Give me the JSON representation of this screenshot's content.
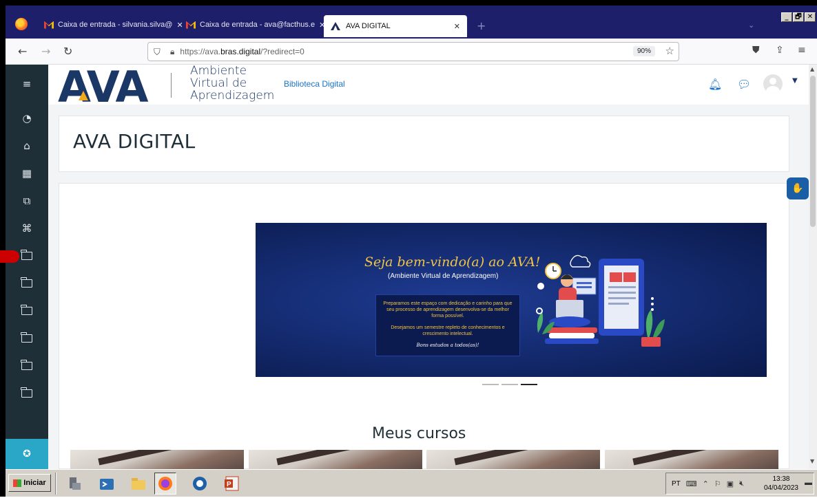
{
  "browser": {
    "tabs": [
      {
        "label": "Caixa de entrada - silvania.silva@",
        "close": "✕"
      },
      {
        "label": "Caixa de entrada - ava@facthus.e",
        "close": "✕"
      },
      {
        "label": "AVA DIGITAL",
        "close": "✕"
      }
    ],
    "new_tab": "+",
    "url_prefix": "https://ava.",
    "url_domain": "bras.digital",
    "url_suffix": "/?redirect=0",
    "zoom": "90%",
    "window_buttons": [
      "_",
      "🗗",
      "✕"
    ]
  },
  "header": {
    "logo_text": "AVA",
    "logo_sub": [
      "Ambiente",
      "Virtual de",
      "Aprendizagem"
    ],
    "nav_link": "Biblioteca Digital"
  },
  "page": {
    "title": "AVA DIGITAL",
    "banner": {
      "welcome": "Seja bem-vindo(a) ao AVA!",
      "subtitle": "(Ambiente Virtual de Aprendizagem)",
      "message_1": "Preparamos este espaço com dedicação e carinho para que seu processo de aprendizagem desenvolva-se da melhor forma possível.",
      "message_2": "Desejamos um semestre repleto de conhecimentos e crescimento intelectual.",
      "sign": "Bons estudos a todos(as)!"
    },
    "carousel": {
      "total": 3,
      "active": 3
    },
    "courses_heading": "Meus cursos"
  },
  "sidebar": {
    "items": [
      "menu-icon",
      "dashboard-icon",
      "home-icon",
      "calendar-icon",
      "files-icon",
      "graduation-cap-icon",
      "folder-icon",
      "folder-icon",
      "folder-icon",
      "folder-icon",
      "folder-icon",
      "folder-icon"
    ]
  },
  "taskbar": {
    "start_label": "Iniciar",
    "language": "PT",
    "time": "13:38",
    "date": "04/04/2023"
  },
  "colors": {
    "tabbar": "#1d1f6b",
    "sidebar": "#1f2f38",
    "brand_blue": "#1a3766",
    "brand_yellow": "#f2a91c",
    "link_blue": "#1a73c8",
    "sidebar_accent": "#2aa6c7"
  }
}
